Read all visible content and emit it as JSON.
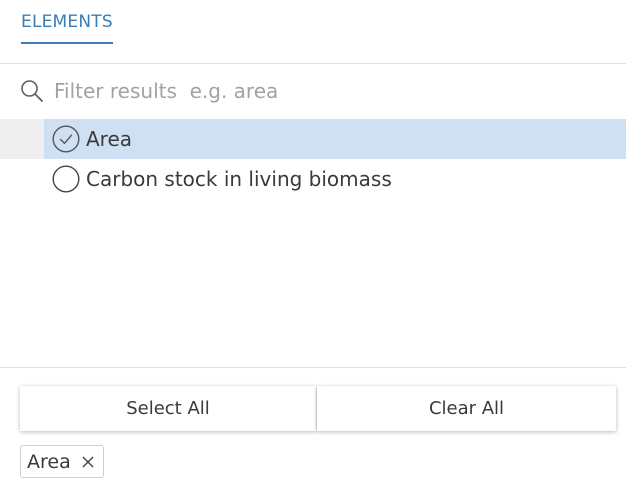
{
  "tabs": [
    {
      "label": "ELEMENTS",
      "active": true
    }
  ],
  "filter": {
    "placeholder": "Filter results  e.g. area",
    "value": ""
  },
  "items": [
    {
      "label": "Area",
      "selected": true
    },
    {
      "label": "Carbon stock in living biomass",
      "selected": false
    }
  ],
  "actions": {
    "select_all": "Select All",
    "clear_all": "Clear All"
  },
  "chips": [
    {
      "label": "Area"
    }
  ],
  "icons": {
    "search": "search-icon",
    "selected": "check-circle-icon",
    "unselected": "empty-circle-icon",
    "remove": "close-icon"
  },
  "colors": {
    "accent": "#3a7cb6",
    "selection": "#cee0f2"
  }
}
